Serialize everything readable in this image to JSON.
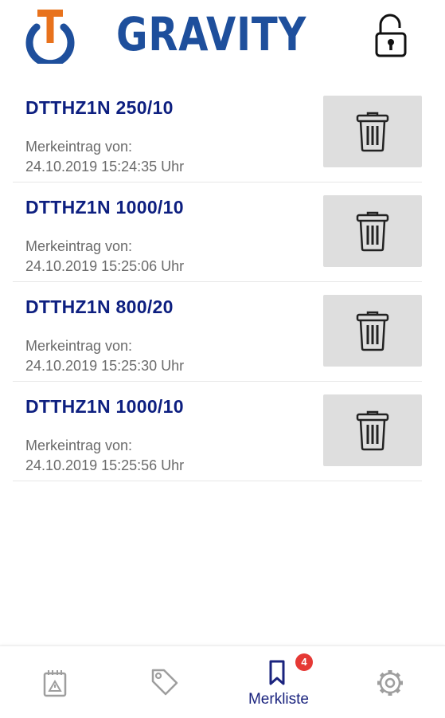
{
  "header": {
    "brand": "GRAVITY",
    "logo_icon": "gravity-logo-icon",
    "lock_icon": "unlocked-padlock-icon"
  },
  "bookmarks": [
    {
      "title": "DTTHZ1N 250/10",
      "meta_label": "Merkeintrag von:",
      "timestamp": "24.10.2019 15:24:35 Uhr"
    },
    {
      "title": "DTTHZ1N 1000/10",
      "meta_label": "Merkeintrag von:",
      "timestamp": "24.10.2019 15:25:06 Uhr"
    },
    {
      "title": "DTTHZ1N 800/20",
      "meta_label": "Merkeintrag von:",
      "timestamp": "24.10.2019 15:25:30 Uhr"
    },
    {
      "title": "DTTHZ1N 1000/10",
      "meta_label": "Merkeintrag von:",
      "timestamp": "24.10.2019 15:25:56 Uhr"
    }
  ],
  "delete_icon": "trash-can-icon",
  "bottom_nav": {
    "items": [
      {
        "icon": "product-box-icon",
        "label": "",
        "active": false
      },
      {
        "icon": "tag-icon",
        "label": "",
        "active": false
      },
      {
        "icon": "bookmark-icon",
        "label": "Merkliste",
        "active": true,
        "badge": "4"
      },
      {
        "icon": "gear-icon",
        "label": "",
        "active": false
      }
    ]
  },
  "colors": {
    "brand_blue": "#1e4f9c",
    "logo_orange": "#e8721c",
    "title_navy": "#0d1f80",
    "meta_gray": "#6b6b6b",
    "delete_bg": "#dedede",
    "active_nav": "#1a237e",
    "inactive_nav": "#9e9e9e",
    "badge_red": "#e53935"
  }
}
